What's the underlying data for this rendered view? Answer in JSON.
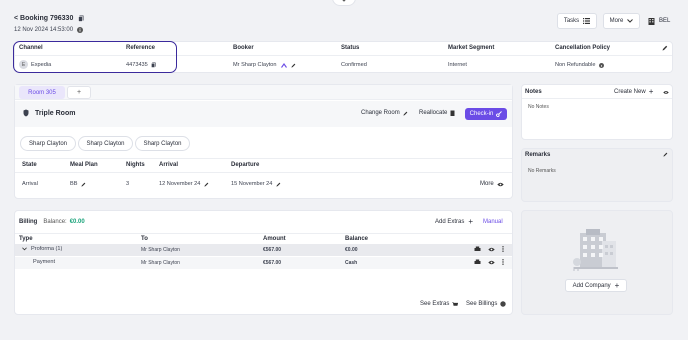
{
  "header": {
    "booking_title": "< Booking 796330",
    "timestamp": "12 Nov 2024 14:53:00",
    "tasks_label": "Tasks",
    "more_label": "More",
    "property_code": "BEL"
  },
  "summary": {
    "columns": [
      "Channel",
      "Reference",
      "Booker",
      "Status",
      "Market Segment",
      "Cancellation Policy"
    ],
    "channel": "Expedia",
    "channel_avatar": "E",
    "reference": "4473435",
    "booker": "Mr Sharp Clayton",
    "status": "Confirmed",
    "market_segment": "Internet",
    "cancellation_policy": "Non Refundable"
  },
  "room": {
    "tab_label": "Room 305",
    "add_tab": "+",
    "room_type": "Triple Room",
    "change_room": "Change Room",
    "reallocate": "Reallocate",
    "check_in": "Check-in",
    "guests": [
      "Sharp Clayton",
      "Sharp Clayton",
      "Sharp Clayton"
    ],
    "table_headers": [
      "State",
      "Meal Plan",
      "Nights",
      "Arrival",
      "Departure"
    ],
    "state": "Arrival",
    "meal_plan": "BB",
    "nights": "3",
    "arrival": "12 November 24",
    "departure": "15 November 24",
    "more_label": "More"
  },
  "billing": {
    "title": "Billing",
    "balance_label": "Balance:",
    "balance_value": "€0.00",
    "add_extras": "Add Extras",
    "manual": "Manual",
    "headers": [
      "Type",
      "To",
      "Amount",
      "Balance"
    ],
    "rows": [
      {
        "type": "Proforma (1)",
        "to": "Mr Sharp Clayton",
        "amount": "€567.00",
        "balance": "€0.00"
      },
      {
        "type": "Payment",
        "to": "Mr Sharp Clayton",
        "amount": "€567.00",
        "balance": "Cash"
      }
    ],
    "see_extras": "See Extras",
    "see_billings": "See Billings"
  },
  "notes": {
    "title": "Notes",
    "create_new": "Create New",
    "empty": "No Notes"
  },
  "remarks": {
    "title": "Remarks",
    "empty": "No Remarks"
  },
  "company": {
    "add_company": "Add Company"
  },
  "colors": {
    "accent": "#6b4ce6",
    "highlight_ring": "#3b2a9c",
    "balance_green": "#1aa37a"
  }
}
